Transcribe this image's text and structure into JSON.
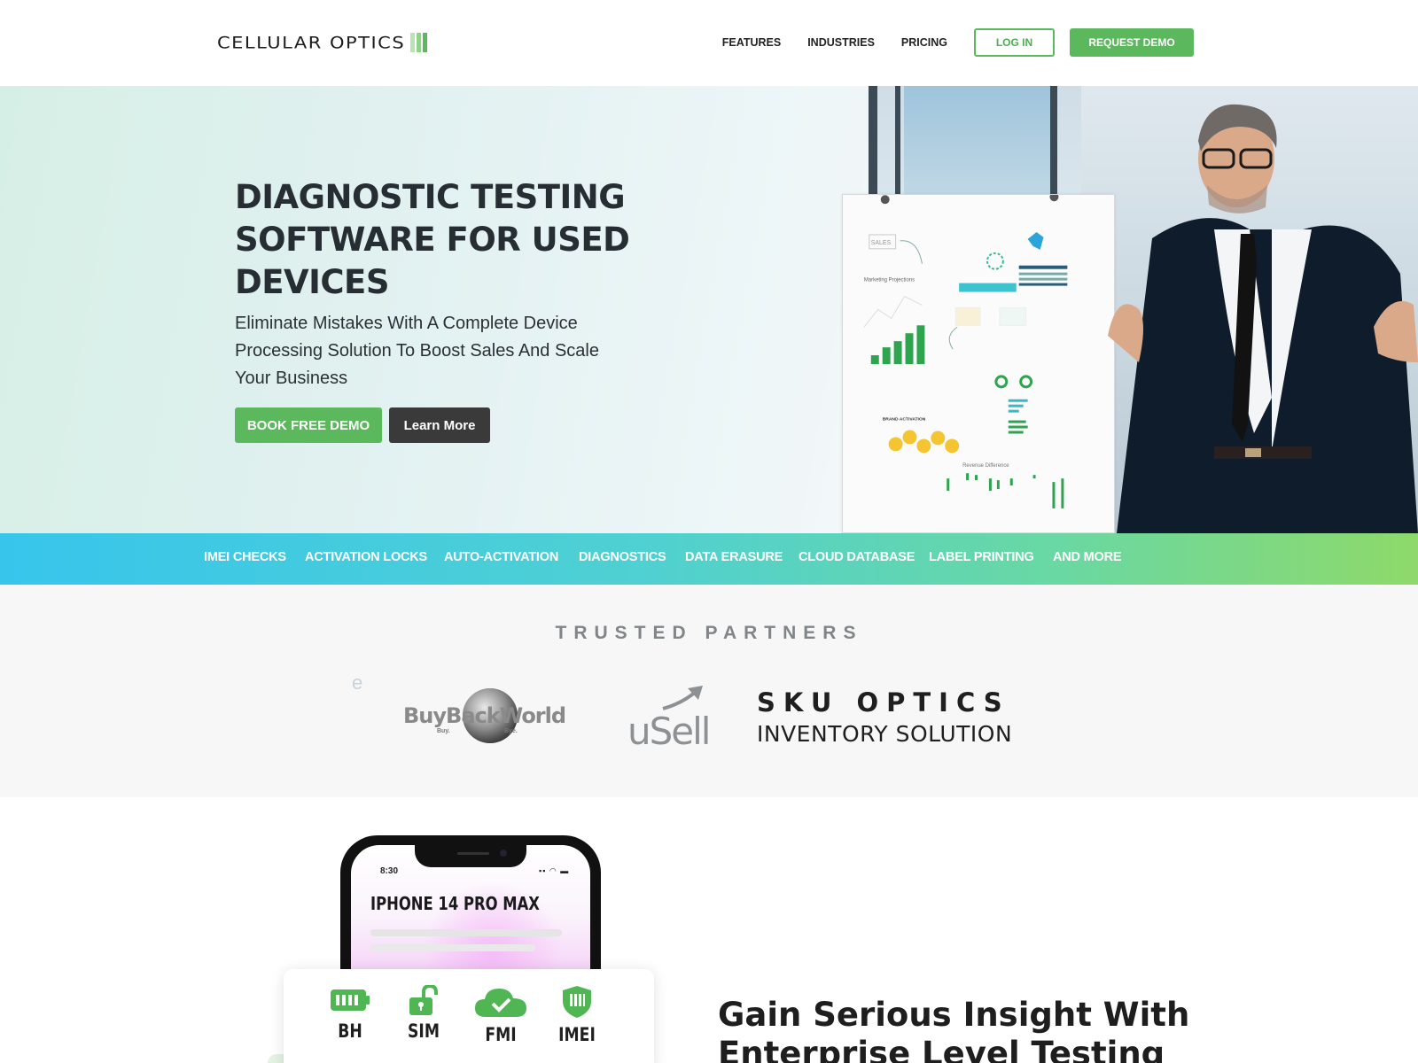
{
  "header": {
    "logo_text": "CELLULAR OPTICS",
    "nav": [
      "FEATURES",
      "INDUSTRIES",
      "PRICING"
    ],
    "login_label": "LOG IN",
    "request_label": "REQUEST DEMO"
  },
  "hero": {
    "title_lines": [
      "DIAGNOSTIC TESTING",
      "SOFTWARE FOR USED",
      "DEVICES"
    ],
    "subtitle": "Eliminate Mistakes With A Complete Device Processing Solution To Boost Sales And Scale Your Business",
    "book_label": "BOOK FREE DEMO",
    "learn_label": "Learn More",
    "flipchart": {
      "sales_label": "SALES",
      "marketing_label": "Marketing Projections",
      "brand_label": "BRAND ACTIVATION",
      "revenue_label": "Revenue Difference"
    }
  },
  "features": [
    "IMEI CHECKS",
    "ACTIVATION LOCKS",
    "AUTO-ACTIVATION",
    "DIAGNOSTICS",
    "DATA ERASURE",
    "CLOUD DATABASE",
    "LABEL PRINTING",
    "AND MORE"
  ],
  "partners": {
    "title": "TRUSTED PARTNERS",
    "stray_letter": "e",
    "buyback": {
      "name": "BuyBackWorld",
      "tagline_left": "Buy.",
      "tagline_right": "Bye."
    },
    "usell": "uSell",
    "sku_top": "SKU OPTICS",
    "sku_bottom": "INVENTORY SOLUTION"
  },
  "lower": {
    "phone_time": "8:30",
    "phone_model": "IPHONE 14 PRO MAX",
    "checks": [
      {
        "label": "BH",
        "icon": "battery-icon"
      },
      {
        "label": "SIM",
        "icon": "unlock-icon"
      },
      {
        "label": "FMI",
        "icon": "cloud-check-icon"
      },
      {
        "label": "IMEI",
        "icon": "shield-bars-icon"
      }
    ],
    "title_lines": [
      "Gain Serious Insight With",
      "Enterprise Level Testing"
    ]
  },
  "colors": {
    "brand_green": "#5cb85c",
    "strip_start": "#37c5ec",
    "strip_end": "#8ed96a",
    "dark_button": "#3a3a3a"
  }
}
